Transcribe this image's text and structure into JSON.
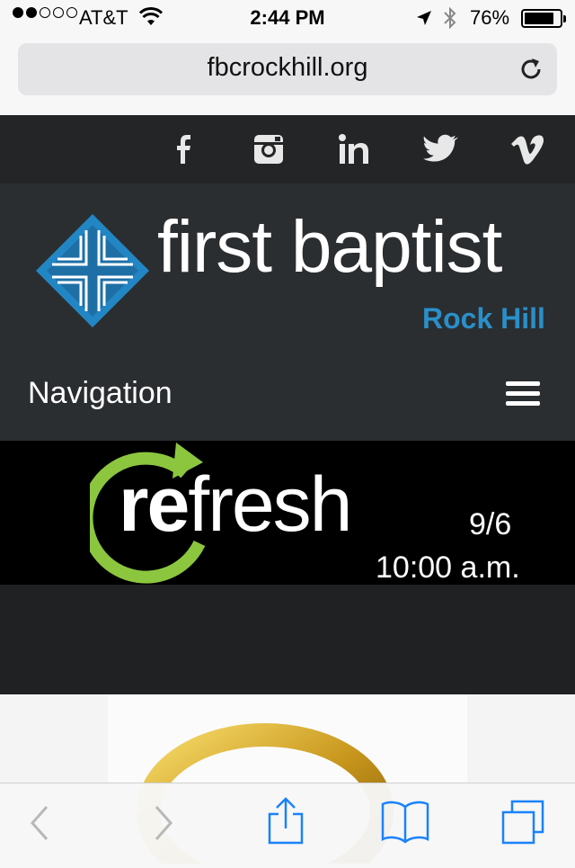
{
  "status_bar": {
    "carrier": "AT&T",
    "time": "2:44 PM",
    "battery": "76%",
    "signal_bars_filled": 2,
    "signal_bars_total": 5
  },
  "browser": {
    "url": "fbcrockhill.org"
  },
  "site": {
    "social_icons": [
      "facebook-icon",
      "instagram-icon",
      "linkedin-icon",
      "twitter-icon",
      "vimeo-icon"
    ],
    "logo": {
      "name": "first baptist",
      "sub": "Rock Hill"
    },
    "nav_label": "Navigation",
    "banner": {
      "re": "re",
      "fresh": "fresh",
      "date": "9/6",
      "time": "10:00 a.m."
    }
  },
  "colors": {
    "accent_blue": "#2a8fc9",
    "refresh_green": "#8cc63f",
    "ios_blue": "#1a82fb"
  }
}
